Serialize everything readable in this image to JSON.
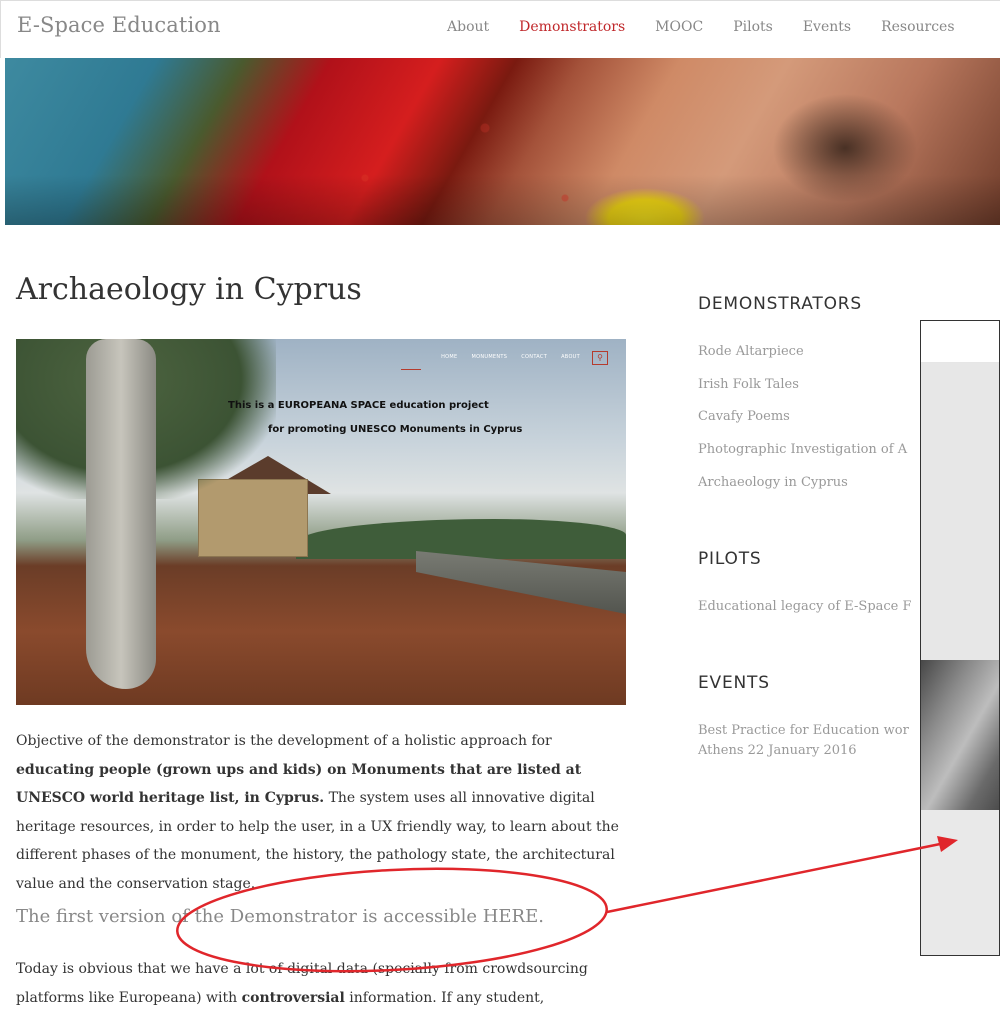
{
  "brand": "E-Space Education",
  "nav": [
    {
      "label": "About"
    },
    {
      "label": "Demonstrators",
      "active": true
    },
    {
      "label": "MOOC"
    },
    {
      "label": "Pilots"
    },
    {
      "label": "Events"
    },
    {
      "label": "Resources"
    }
  ],
  "page_title": "Archaeology in Cyprus",
  "photo": {
    "nav": [
      "HOME",
      "MONUMENTS",
      "CONTACT",
      "ABOUT"
    ],
    "search_icon": "search-icon",
    "overlay_line1": "This is a EUROPEANA SPACE education project",
    "overlay_line2": "for promoting UNESCO Monuments in Cyprus"
  },
  "body": {
    "p1_a": "Objective of the demonstrator is the development of a holistic approach for ",
    "p1_b": "educating people (grown ups and kids) on Monuments that are listed at UNESCO world heritage list, in Cyprus.",
    "p1_c": " The system uses all innovative digital heritage resources, in order to help the user, in a UX friendly way, to learn about the different phases of the monument, the history, the pathology state, the architectural value and the conservation stage.",
    "first_version": "The first version of the Demonstrator is accessible HERE.",
    "p2_a": "Today is obvious that we have a lot of digital data (specially from crowdsourcing platforms like Europeana) with ",
    "p2_b": "controversial",
    "p2_c": " information. If any student,"
  },
  "sidebar": {
    "demonstrators_heading": "DEMONSTRATORS",
    "demonstrators": [
      "Rode Altarpiece",
      "Irish Folk Tales",
      "Cavafy Poems",
      "Photographic Investigation of A",
      "Archaeology in Cyprus"
    ],
    "pilots_heading": "PILOTS",
    "pilots": [
      "Educational legacy of E-Space F"
    ],
    "events_heading": "EVENTS",
    "events_line1": "Best Practice for Education wor",
    "events_line2": "Athens 22 January 2016"
  },
  "colors": {
    "accent": "#c0282b",
    "annotation": "#e0262b",
    "muted_text": "#999999"
  }
}
